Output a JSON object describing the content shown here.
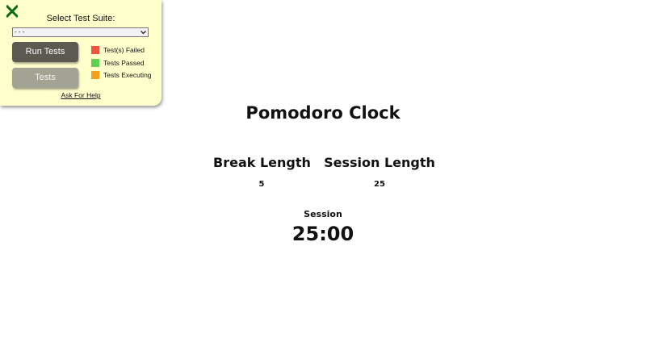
{
  "test_panel": {
    "close_icon": "close-x-icon",
    "suite_label": "Select Test Suite:",
    "suite_select_value": "- - -",
    "run_button_label": "Run Tests",
    "tests_button_label": "Tests",
    "legend": [
      {
        "label": "Test(s) Failed",
        "color": "#f0533f"
      },
      {
        "label": "Tests Passed",
        "color": "#5ed14f"
      },
      {
        "label": "Tests Executing",
        "color": "#f59f1c"
      }
    ],
    "help_link": "Ask For Help",
    "accent_color": "#0a6b12"
  },
  "clock": {
    "title": "Pomodoro Clock",
    "break_label": "Break Length",
    "break_value": "5",
    "session_label": "Session Length",
    "session_value": "25",
    "timer_label": "Session",
    "time_left": "25:00"
  }
}
